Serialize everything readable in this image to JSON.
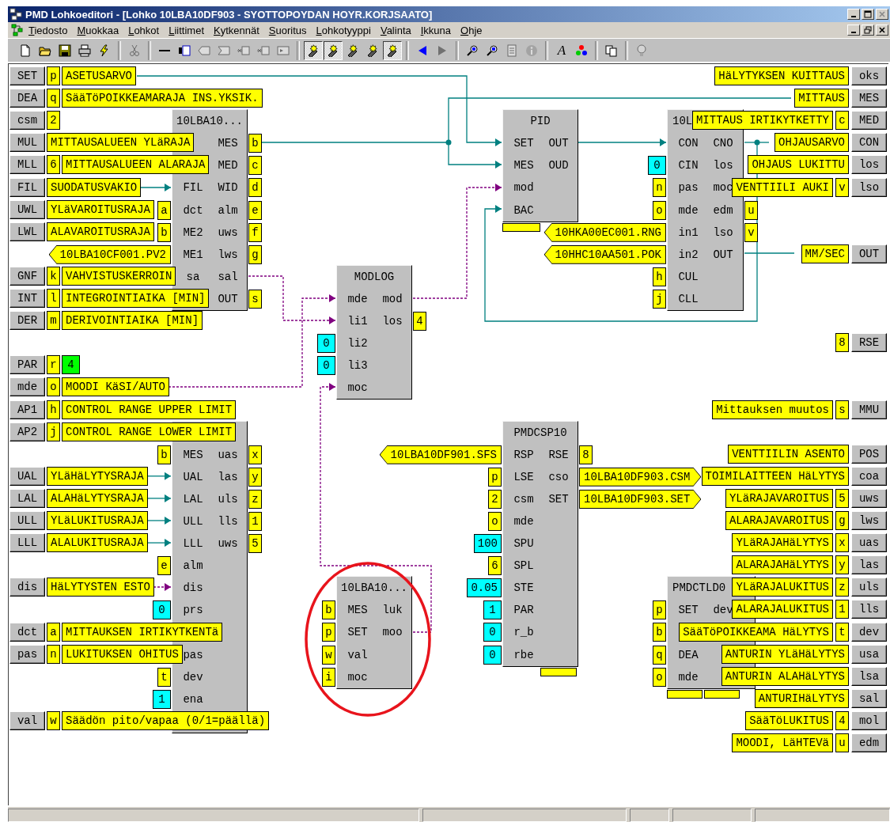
{
  "window": {
    "title": "PMD Lohkoeditori - [Lohko 10LBA10DF903 - SYOTTOPOYDAN HOYR.KORJSAATO]"
  },
  "menu": [
    "Tiedosto",
    "Muokkaa",
    "Lohkot",
    "Liittimet",
    "Kytkennät",
    "Suoritus",
    "Lohkotyyppi",
    "Valinta",
    "Ikkuna",
    "Ohje"
  ],
  "toolbar": [
    [
      {
        "kind": "new",
        "pressed": false,
        "disabled": false
      },
      {
        "kind": "open",
        "pressed": false,
        "disabled": false
      },
      {
        "kind": "save",
        "pressed": false,
        "disabled": false
      },
      {
        "kind": "print",
        "pressed": false,
        "disabled": false
      },
      {
        "kind": "run",
        "pressed": false,
        "disabled": false
      }
    ],
    [
      {
        "kind": "cut",
        "pressed": false,
        "disabled": true
      }
    ],
    [
      {
        "kind": "line",
        "pressed": false,
        "disabled": false
      },
      {
        "kind": "block",
        "pressed": false,
        "disabled": false
      },
      {
        "kind": "pin_arrow",
        "pressed": false,
        "disabled": true
      },
      {
        "kind": "pin_notch",
        "pressed": false,
        "disabled": true
      },
      {
        "kind": "pin_star",
        "pressed": false,
        "disabled": true
      },
      {
        "kind": "pin_star",
        "pressed": false,
        "disabled": true
      },
      {
        "kind": "pin_field",
        "pressed": false,
        "disabled": true
      }
    ],
    [
      {
        "kind": "pen_star",
        "pressed": true,
        "disabled": false
      },
      {
        "kind": "pen_arrow",
        "pressed": true,
        "disabled": false
      },
      {
        "kind": "pen_dot",
        "pressed": false,
        "disabled": false
      },
      {
        "kind": "pen_dot",
        "pressed": false,
        "disabled": false
      },
      {
        "kind": "pen_field",
        "pressed": true,
        "disabled": false
      }
    ],
    [
      {
        "kind": "back",
        "pressed": false,
        "disabled": false
      },
      {
        "kind": "forward",
        "pressed": false,
        "disabled": true
      }
    ],
    [
      {
        "kind": "zoom",
        "pressed": false,
        "disabled": false
      },
      {
        "kind": "zoom",
        "pressed": false,
        "disabled": false
      },
      {
        "kind": "report",
        "pressed": false,
        "disabled": true
      },
      {
        "kind": "info",
        "pressed": false,
        "disabled": true
      }
    ],
    [
      {
        "kind": "font",
        "label": "A",
        "pressed": false,
        "disabled": false
      },
      {
        "kind": "colors",
        "pressed": false,
        "disabled": false
      }
    ],
    [
      {
        "kind": "copy",
        "pressed": false,
        "disabled": false
      }
    ],
    [
      {
        "kind": "help",
        "pressed": false,
        "disabled": true
      }
    ]
  ],
  "left_terminals": [
    {
      "code": "SET",
      "tag": "p",
      "label": "ASETUSARVO"
    },
    {
      "code": "DEA",
      "tag": "q",
      "label": "SääTöPOIKKEAMARAJA INS.YKSIK."
    },
    {
      "code": "csm",
      "tag": "2"
    },
    {
      "code": "MUL",
      "label": "MITTAUSALUEEN YLäRAJA"
    },
    {
      "code": "MLL",
      "tag": "6",
      "label": "MITTAUSALUEEN ALARAJA"
    },
    {
      "code": "FIL",
      "label": "SUODATUSVAKIO"
    },
    {
      "code": "UWL",
      "label": "YLäVAROITUSRAJA"
    },
    {
      "code": "LWL",
      "label": "ALAVAROITUSRAJA"
    },
    {
      "code": "GNF",
      "tag": "k",
      "label": "VAHVISTUSKERROIN"
    },
    {
      "code": "INT",
      "tag": "l",
      "label": "INTEGROINTIAIKA [MIN]"
    },
    {
      "code": "DER",
      "tag": "m",
      "label": "DERIVOINTIAIKA [MIN]"
    },
    {
      "code": "PAR",
      "tag": "r",
      "constant": {
        "text": "4",
        "color": "#00ff00"
      }
    },
    {
      "code": "mde",
      "tag": "o",
      "label": "MOODI KäSI/AUTO"
    },
    {
      "code": "AP1",
      "tag": "h",
      "label": "CONTROL RANGE UPPER LIMIT"
    },
    {
      "code": "AP2",
      "tag": "j",
      "label": "CONTROL RANGE LOWER LIMIT"
    },
    {
      "code": "UAL",
      "label": "YLäHäLYTYSRAJA"
    },
    {
      "code": "LAL",
      "label": "ALAHäLYTYSRAJA"
    },
    {
      "code": "ULL",
      "label": "YLäLUKITUSRAJA"
    },
    {
      "code": "LLL",
      "label": "ALALUKITUSRAJA"
    },
    {
      "code": "dis",
      "label": "HäLYTYSTEN ESTO"
    },
    {
      "code": "dct",
      "tag": "a",
      "label": "MITTAUKSEN IRTIKYTKENTä"
    },
    {
      "code": "pas",
      "tag": "n",
      "label": "LUKITUKSEN OHITUS"
    },
    {
      "code": "val",
      "tag": "w",
      "label": "Säädön pito/vapaa (0/1=päällä)"
    }
  ],
  "blocks": [
    {
      "title": "10LBA10...",
      "pins": [
        {
          "right": "MES",
          "out": {
            "kind": "tag",
            "text": "b"
          }
        },
        {
          "right": "MED",
          "out": {
            "kind": "tag",
            "text": "c"
          }
        },
        {
          "left": "FIL",
          "right": "WID",
          "out": {
            "kind": "tag",
            "text": "d"
          }
        },
        {
          "left": "dct",
          "right": "alm",
          "in": {
            "kind": "tag",
            "text": "a"
          },
          "out": {
            "kind": "tag",
            "text": "e"
          }
        },
        {
          "left": "ME2",
          "right": "uws",
          "in": {
            "kind": "tag",
            "text": "b"
          },
          "out": {
            "kind": "tag",
            "text": "f"
          }
        },
        {
          "left": "ME1",
          "right": "lws",
          "in": {
            "kind": "pointer_in",
            "text": "10LBA10CF001.PV2"
          },
          "out": {
            "kind": "tag",
            "text": "g"
          }
        },
        {
          "left": "sa",
          "right": "sal"
        },
        {
          "right": "OUT",
          "out": {
            "kind": "tag",
            "text": "s"
          }
        }
      ]
    },
    {
      "pins": [
        {
          "left": "MES",
          "right": "uas",
          "in": {
            "kind": "tag",
            "text": "b"
          },
          "out": {
            "kind": "tag",
            "text": "x"
          }
        },
        {
          "left": "UAL",
          "right": "las",
          "out": {
            "kind": "tag",
            "text": "y"
          }
        },
        {
          "left": "LAL",
          "right": "uls",
          "out": {
            "kind": "tag",
            "text": "z"
          }
        },
        {
          "left": "ULL",
          "right": "lls",
          "out": {
            "kind": "tag",
            "text": "1"
          }
        },
        {
          "left": "LLL",
          "right": "uws",
          "out": {
            "kind": "tag",
            "text": "5"
          }
        },
        {
          "left": "alm",
          "in": {
            "kind": "tag",
            "text": "e"
          }
        },
        {
          "left": "dis"
        },
        {
          "left": "prs",
          "in": {
            "kind": "constant",
            "text": "0",
            "color": "#00ffff"
          }
        },
        {
          "left": "pas"
        },
        {
          "left": "dev",
          "in": {
            "kind": "tag",
            "text": "t"
          }
        },
        {
          "left": "ena",
          "in": {
            "kind": "constant",
            "text": "1",
            "color": "#00ffff"
          }
        }
      ]
    },
    {
      "title": "MODLOG",
      "pins": [
        {
          "left": "mde",
          "right": "mod"
        },
        {
          "left": "li1",
          "right": "los",
          "out": {
            "kind": "tag",
            "text": "4"
          }
        },
        {
          "left": "li2",
          "in": {
            "kind": "constant",
            "text": "0",
            "color": "#00ffff"
          }
        },
        {
          "left": "li3",
          "in": {
            "kind": "constant",
            "text": "0",
            "color": "#00ffff"
          }
        },
        {
          "left": "moc"
        }
      ]
    },
    {
      "title": "PID",
      "pins": [
        {
          "left": "SET",
          "right": "OUT"
        },
        {
          "left": "MES",
          "right": "OUD"
        },
        {
          "left": "mod"
        },
        {
          "left": "BAC"
        }
      ]
    },
    {
      "title": "10L",
      "pins": [
        {
          "left": "CON",
          "right": "CNO"
        },
        {
          "left": "CIN",
          "right": "los",
          "in": {
            "kind": "constant",
            "text": "0",
            "color": "#00ffff"
          }
        },
        {
          "left": "pas",
          "right": "moc",
          "in": {
            "kind": "tag",
            "text": "n"
          }
        },
        {
          "left": "mde",
          "right": "edm",
          "in": {
            "kind": "tag",
            "text": "o"
          },
          "out": {
            "kind": "tag",
            "text": "u"
          }
        },
        {
          "left": "in1",
          "right": "lso",
          "in": {
            "kind": "pointer_in",
            "text": "10HKA00EC001.RNG"
          },
          "out": {
            "kind": "tag",
            "text": "v"
          }
        },
        {
          "left": "in2",
          "right": "OUT",
          "in": {
            "kind": "pointer_in",
            "text": "10HHC10AA501.POK"
          }
        },
        {
          "left": "CUL",
          "in": {
            "kind": "tag",
            "text": "h"
          }
        },
        {
          "left": "CLL",
          "in": {
            "kind": "tag",
            "text": "j"
          }
        }
      ]
    },
    {
      "title": "PMDCSP10",
      "pins": [
        {
          "left": "RSP",
          "right": "RSE",
          "in": {
            "kind": "pointer_in",
            "text": "10LBA10DF901.SFS"
          },
          "out": {
            "kind": "tag",
            "text": "8"
          }
        },
        {
          "left": "LSE",
          "right": "cso",
          "in": {
            "kind": "tag",
            "text": "p"
          },
          "out": {
            "kind": "pointer_out",
            "text": "10LBA10DF903.CSM"
          }
        },
        {
          "left": "csm",
          "right": "SET",
          "in": {
            "kind": "tag",
            "text": "2"
          },
          "out": {
            "kind": "pointer_out",
            "text": "10LBA10DF903.SET"
          }
        },
        {
          "left": "mde",
          "in": {
            "kind": "tag",
            "text": "o"
          }
        },
        {
          "left": "SPU",
          "in": {
            "kind": "constant",
            "text": "100",
            "color": "#00ffff"
          }
        },
        {
          "left": "SPL",
          "in": {
            "kind": "tag",
            "text": "6"
          }
        },
        {
          "left": "STE",
          "in": {
            "kind": "constant",
            "text": "0.05",
            "color": "#00ffff"
          }
        },
        {
          "left": "PAR",
          "in": {
            "kind": "constant",
            "text": "1",
            "color": "#00ffff"
          }
        },
        {
          "left": "r_b",
          "in": {
            "kind": "constant",
            "text": "0",
            "color": "#00ffff"
          }
        },
        {
          "left": "rbe",
          "in": {
            "kind": "constant",
            "text": "0",
            "color": "#00ffff"
          }
        }
      ]
    },
    {
      "title": "10LBA10...",
      "pins": [
        {
          "left": "MES",
          "right": "luk",
          "in": {
            "kind": "tag",
            "text": "b"
          }
        },
        {
          "left": "SET",
          "right": "moo",
          "in": {
            "kind": "tag",
            "text": "p"
          }
        },
        {
          "left": "val",
          "in": {
            "kind": "tag",
            "text": "w"
          }
        },
        {
          "left": "moc",
          "in": {
            "kind": "tag",
            "text": "i"
          }
        }
      ]
    },
    {
      "title": "PMDCTLD0",
      "pins": [
        {
          "left": "SET",
          "right": "dev",
          "in": {
            "kind": "tag",
            "text": "p"
          }
        },
        {
          "in": {
            "kind": "tag",
            "text": "b"
          }
        },
        {
          "left": "DEA",
          "in": {
            "kind": "tag",
            "text": "q"
          }
        },
        {
          "left": "mde",
          "in": {
            "kind": "tag",
            "text": "o"
          }
        }
      ]
    }
  ],
  "right_terminals": [
    {
      "label": "HäLYTYKSEN KUITTAUS",
      "code": "oks"
    },
    {
      "label": "MITTAUS",
      "code": "MES"
    },
    {
      "label": "MITTAUS IRTIKYTKETTY",
      "tag": "c",
      "code": "MED"
    },
    {
      "label": "OHJAUSARVO",
      "code": "CON"
    },
    {
      "label": "OHJAUS LUKITTU",
      "code": "los"
    },
    {
      "label": "VENTTIILI AUKI",
      "tag": "v",
      "code": "lso"
    },
    {
      "label": "MM/SEC",
      "code": "OUT"
    },
    {
      "tag": "8",
      "code": "RSE"
    },
    {
      "label": "Mittauksen muutos",
      "tag": "s",
      "code": "MMU"
    },
    {
      "label": "VENTTIILIN ASENTO",
      "code": "POS"
    },
    {
      "label": "TOIMILAITTEEN HäLYTYS",
      "code": "coa"
    },
    {
      "label": "YLäRAJAVAROITUS",
      "tag": "5",
      "code": "uws"
    },
    {
      "label": "ALARAJAVAROITUS",
      "tag": "g",
      "code": "lws"
    },
    {
      "label": "YLäRAJAHäLYTYS",
      "tag": "x",
      "code": "uas"
    },
    {
      "label": "ALARAJAHäLYTYS",
      "tag": "y",
      "code": "las"
    },
    {
      "label": "YLäRAJALUKITUS",
      "tag": "z",
      "code": "uls"
    },
    {
      "label": "ALARAJALUKITUS",
      "tag": "1",
      "code": "lls"
    },
    {
      "label": "SääTöPOIKKEAMA HäLYTYS",
      "tag": "t",
      "code": "dev"
    },
    {
      "label": "ANTURIN YLäHäLYTYS",
      "code": "usa"
    },
    {
      "label": "ANTURIN ALAHäLYTYS",
      "code": "lsa"
    },
    {
      "label": "ANTURIHäLYTYS",
      "code": "sal"
    },
    {
      "label": "SääTöLUKITUS",
      "tag": "4",
      "code": "mol"
    },
    {
      "label": "MOODI, LäHTEVä",
      "tag": "u",
      "code": "edm"
    }
  ]
}
